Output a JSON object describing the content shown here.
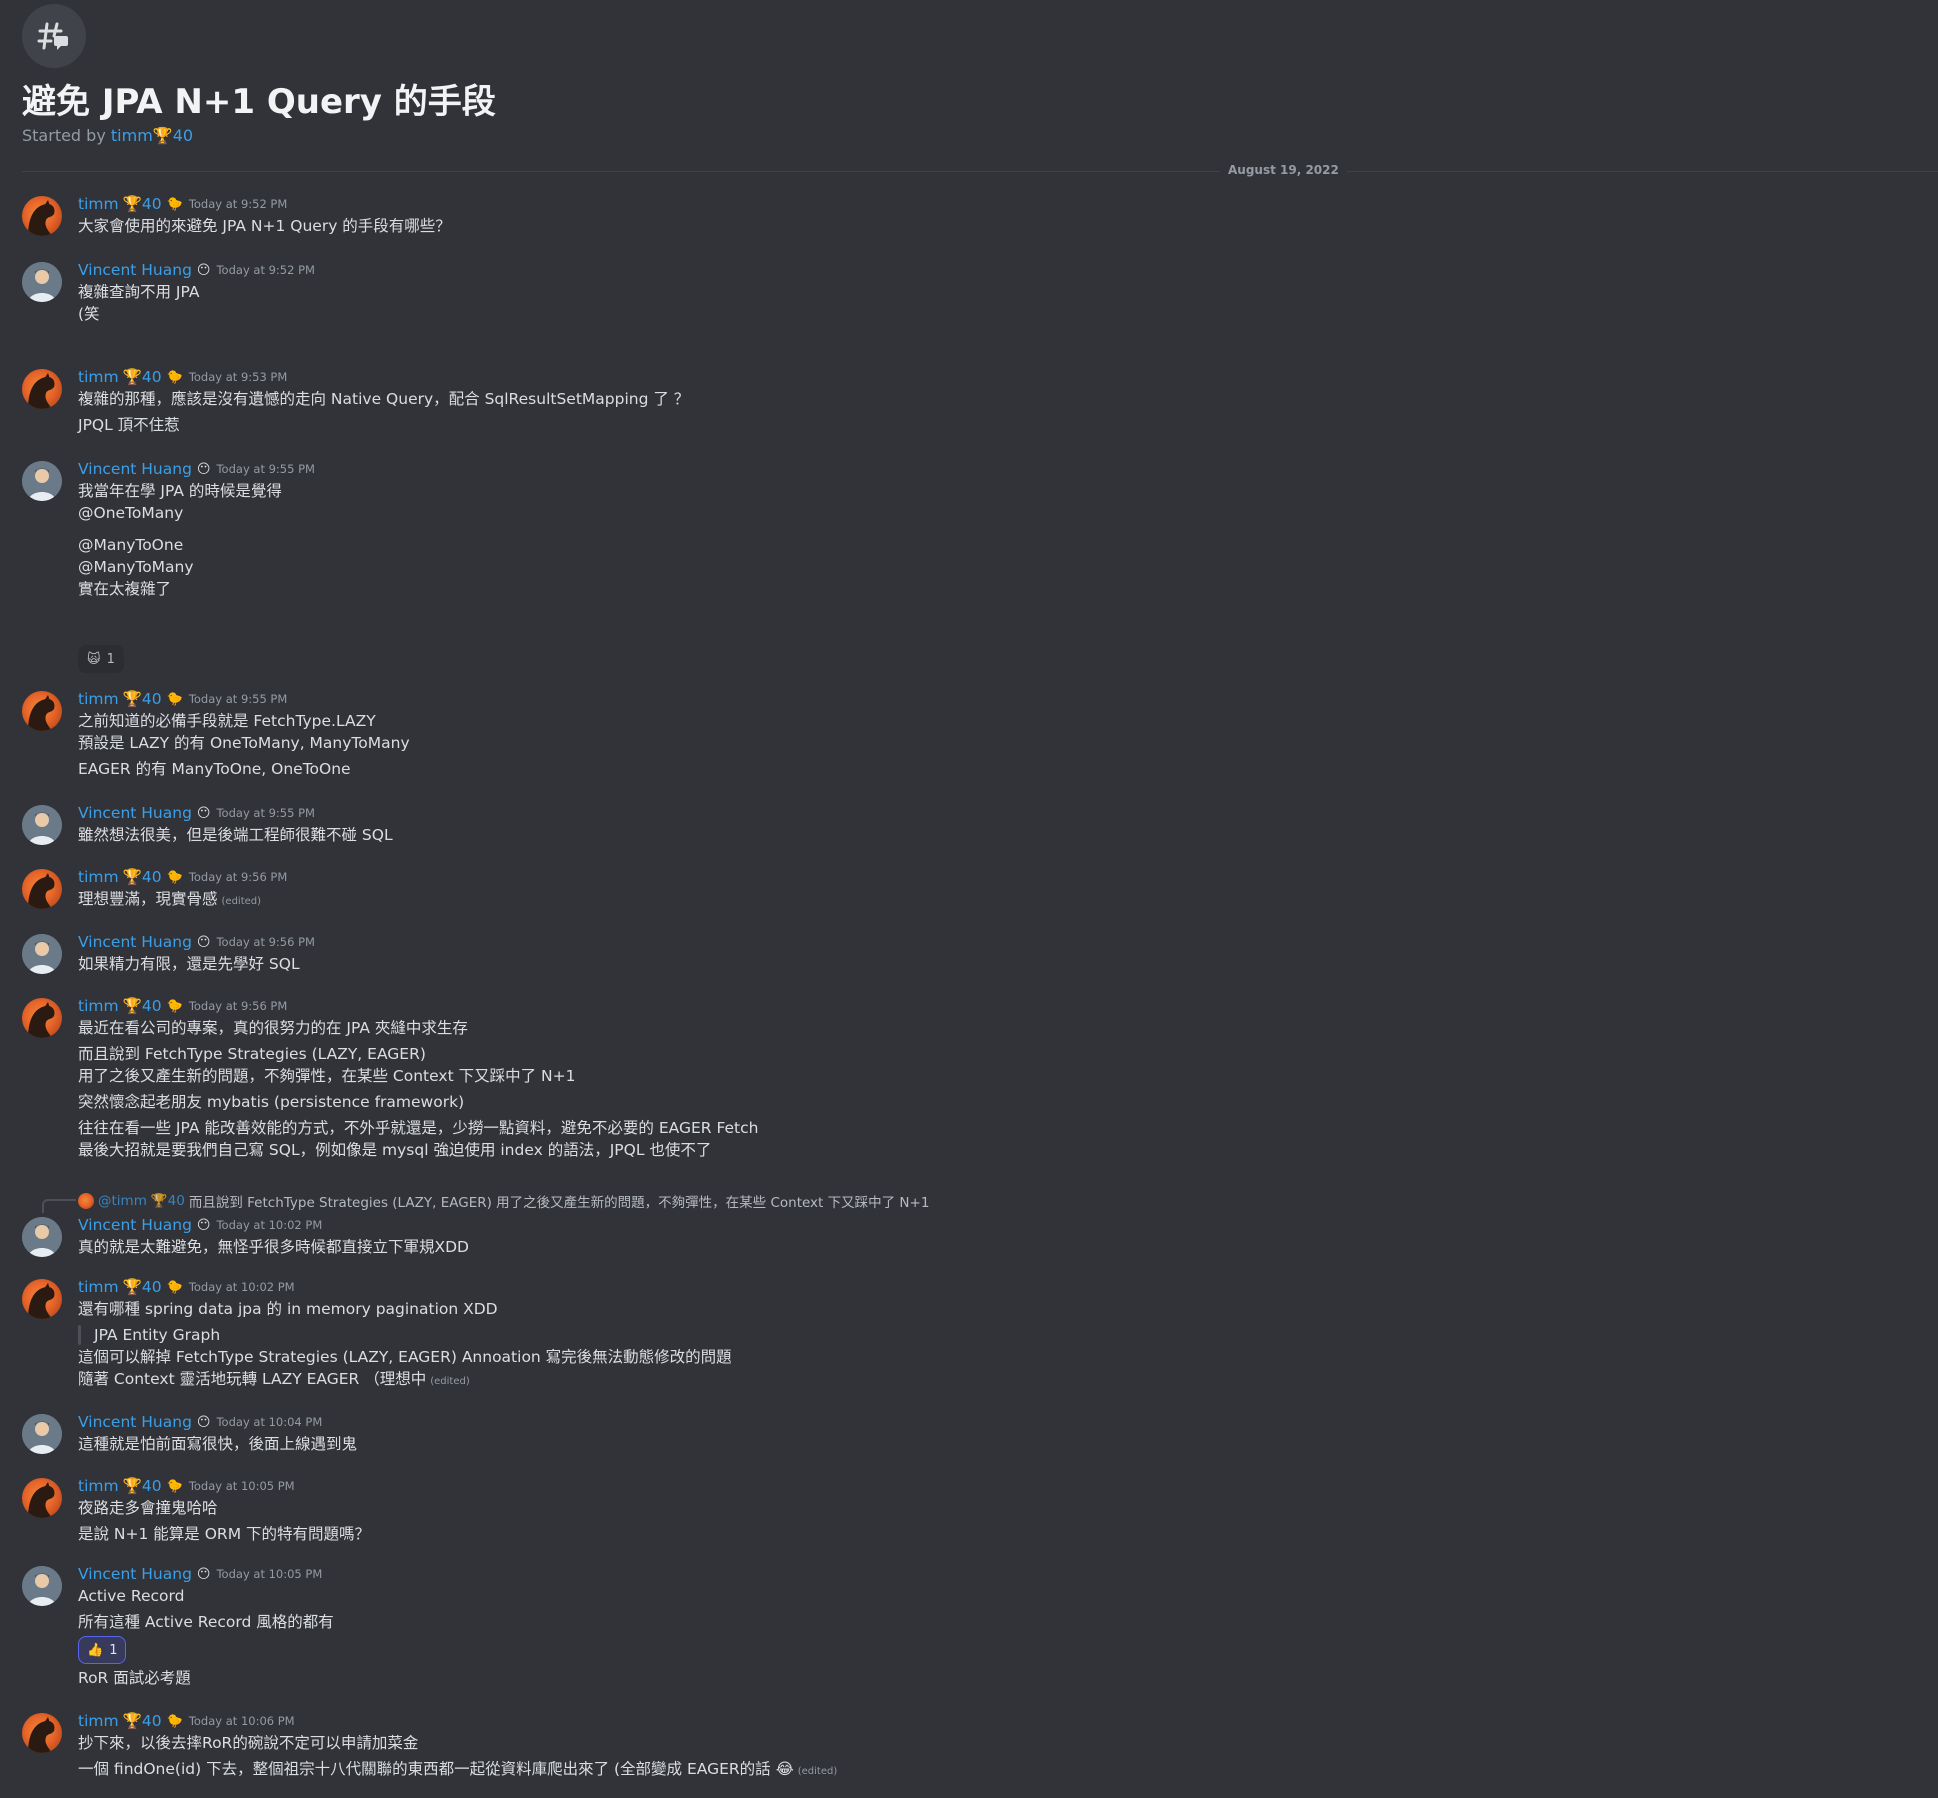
{
  "thread": {
    "title": "避免 JPA N+1 Query 的手段",
    "started_prefix": "Started by",
    "started_user": "timm",
    "started_trophy": "🏆40"
  },
  "date_divider": "August 19, 2022",
  "users": {
    "timm": {
      "name": "timm",
      "trophy": "🏆40",
      "badge": "🐤"
    },
    "vincent": {
      "name": "Vincent Huang",
      "badge": "😶"
    }
  },
  "messages": [
    {
      "user": "timm",
      "time": "Today at 9:52 PM",
      "lines": [
        "大家會使用的來避免 JPA N+1 Query 的手段有哪些？"
      ]
    },
    {
      "user": "vincent",
      "time": "Today at 9:52 PM",
      "lines": [
        "複雜查詢不用 JPA",
        "",
        "(笑"
      ]
    },
    {
      "user": "timm",
      "time": "Today at 9:53 PM",
      "lines": [
        "複雜的那種，應該是沒有遺憾的走向 Native Query，配合 SqlResultSetMapping 了 ？",
        "JPQL 頂不住惹"
      ]
    },
    {
      "user": "vincent",
      "time": "Today at 9:55 PM",
      "lines": [
        "我當年在學 JPA 的時候是覺得",
        "",
        "@OneToMany",
        "@ManyToOne",
        "@ManyToMany",
        "",
        "實在太複雜了"
      ],
      "reaction": {
        "emoji": "🙀",
        "count": "1"
      }
    },
    {
      "user": "timm",
      "time": "Today at 9:55 PM",
      "lines": [
        "之前知道的必備手段就是 FetchType.LAZY",
        "預設是 LAZY 的有 OneToMany, ManyToMany",
        "EAGER 的有 ManyToOne, OneToOne"
      ]
    },
    {
      "user": "vincent",
      "time": "Today at 9:55 PM",
      "lines": [
        "雖然想法很美，但是後端工程師很難不碰 SQL"
      ]
    },
    {
      "user": "timm",
      "time": "Today at 9:56 PM",
      "lines": [
        "理想豐滿，現實骨感"
      ],
      "edited": "(edited)"
    },
    {
      "user": "vincent",
      "time": "Today at 9:56 PM",
      "lines": [
        "如果精力有限，還是先學好 SQL"
      ]
    },
    {
      "user": "timm",
      "time": "Today at 9:56 PM",
      "lines": [
        "最近在看公司的專案，真的很努力的在 JPA 夾縫中求生存",
        "而且說到 FetchType Strategies (LAZY, EAGER)",
        "用了之後又產生新的問題，不夠彈性，在某些 Context 下又踩中了 N+1",
        "突然懷念起老朋友 mybatis (persistence framework)",
        "往往在看一些 JPA 能改善效能的方式，不外乎就還是，少撈一點資料，避免不必要的 EAGER Fetch",
        "最後大招就是要我們自己寫 SQL，例如像是 mysql 強迫使用 index 的語法，JPQL 也使不了"
      ]
    },
    {
      "user": "vincent",
      "time": "Today at 10:02 PM",
      "reply": {
        "user": "@timm",
        "trophy": "🏆40",
        "text": "而且說到 FetchType Strategies (LAZY, EAGER) 用了之後又產生新的問題，不夠彈性，在某些 Context 下又踩中了 N+1"
      },
      "lines": [
        "真的就是太難避免，無怪乎很多時候都直接立下軍規XDD"
      ]
    },
    {
      "user": "timm",
      "time": "Today at 10:02 PM",
      "lines": [
        "還有哪種 spring data jpa 的 in memory pagination XDD",
        "JPA Entity Graph",
        "這個可以解掉 FetchType Strategies (LAZY, EAGER) Annoation 寫完後無法動態修改的問題",
        "隨著 Context 靈活地玩轉 LAZY EAGER （理想中"
      ],
      "edited": "(edited)"
    },
    {
      "user": "vincent",
      "time": "Today at 10:04 PM",
      "lines": [
        "這種就是怕前面寫很快，後面上線遇到鬼"
      ]
    },
    {
      "user": "timm",
      "time": "Today at 10:05 PM",
      "lines": [
        "夜路走多會撞鬼哈哈",
        "是說 N+1 能算是 ORM 下的特有問題嗎？"
      ]
    },
    {
      "user": "vincent",
      "time": "Today at 10:05 PM",
      "lines": [
        "Active Record",
        "所有這種 Active Record 風格的都有",
        "RoR 面試必考題"
      ],
      "reaction": {
        "emoji": "👍",
        "count": "1"
      }
    },
    {
      "user": "timm",
      "time": "Today at 10:06 PM",
      "lines": [
        "抄下來，以後去摔RoR的碗說不定可以申請加菜金",
        "一個 findOne(id) 下去，整個祖宗十八代關聯的東西都一起從資料庫爬出來了 (全部變成 EAGER的話 😂"
      ],
      "edited": "(edited)"
    }
  ]
}
